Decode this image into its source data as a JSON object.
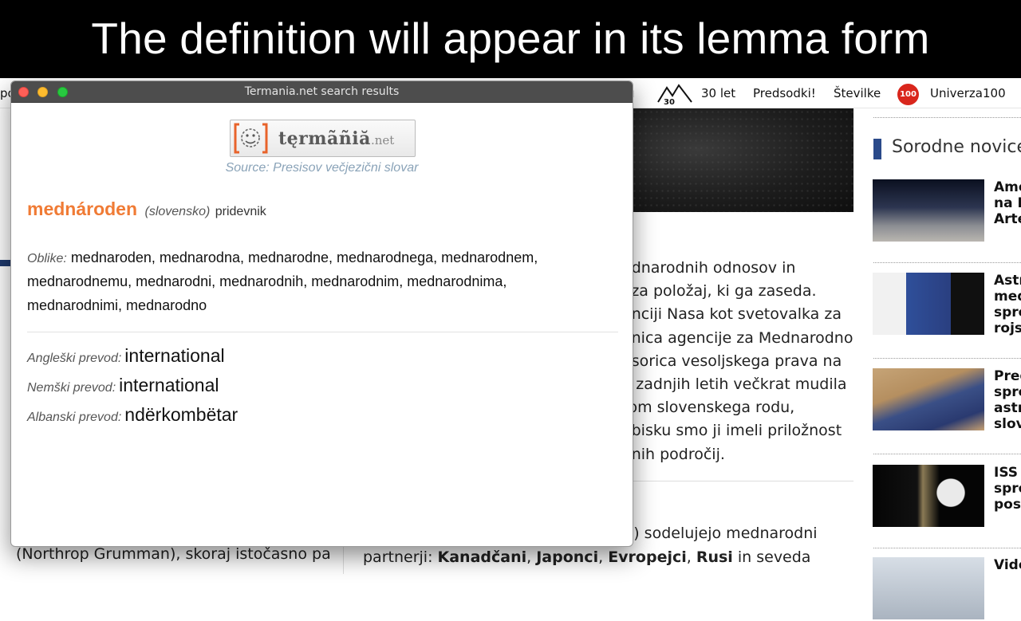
{
  "caption": "The definition will appear in its lemma form",
  "website": {
    "nav": {
      "partial_left": "po",
      "partial_mid": "u",
      "logo_30": "30",
      "items": [
        "30 let",
        "Predsodki!",
        "Številke"
      ],
      "badge_100": "100",
      "univerza": "Univerza100"
    },
    "article_lines": [
      "ednarodnih odnosov in",
      "i za položaj, ki ga zaseda.",
      "enciji Nasa kot svetovalka za",
      "onica agencije za Mednarodno",
      "esorica vesoljskega prava na",
      "v zadnjih letih večkrat mudila",
      "tom slovenskega rodu,",
      "obisku smo ji imeli priložnost",
      "enih področij."
    ],
    "bottom_line1": "') sodelujejo mednarodni",
    "bottom_line2": {
      "start": "partnerji: ",
      "b1": "Kanadčani",
      "sep1": ", ",
      "b2": "Japonci",
      "sep2": ", ",
      "b3": "Evropejci",
      "sep3": ", ",
      "b4": "Rusi",
      "end": " in seveda"
    },
    "left_bottom": "(Northrop Grumman), skoraj istočasno pa",
    "sidebar": {
      "heading": "Sorodne novice",
      "items": [
        {
          "title_lines": [
            "Ame",
            "na L",
            "Arte"
          ]
        },
        {
          "title_lines": [
            "Astr",
            "med",
            "spre",
            "rojs"
          ]
        },
        {
          "title_lines": [
            "Pred",
            "spre",
            "astr",
            "slov"
          ]
        },
        {
          "title_lines": [
            "ISS",
            "spro",
            "post"
          ]
        },
        {
          "title_lines": [
            "Vide"
          ]
        }
      ]
    }
  },
  "dialog": {
    "window_title": "Termania.net search results",
    "logo": {
      "word": "tęrmãñiă",
      "tld": ".net"
    },
    "source": "Source: Presisov večjezični slovar",
    "headword": "mednároden",
    "language": "(slovensko)",
    "part_of_speech": "pridevnik",
    "forms_label": "Oblike:",
    "forms_lines": [
      "mednaroden, mednarodna, mednarodne, mednarodnega, mednarodnem,",
      "mednarodnemu, mednarodni, mednarodnih, mednarodnim, mednarodnima,",
      "mednarodnimi, mednarodno"
    ],
    "translations": [
      {
        "label": "Angleški prevod:",
        "value": "international"
      },
      {
        "label": "Nemški prevod:",
        "value": "international"
      },
      {
        "label": "Albanski prevod:",
        "value": "ndërkombëtar"
      }
    ]
  }
}
